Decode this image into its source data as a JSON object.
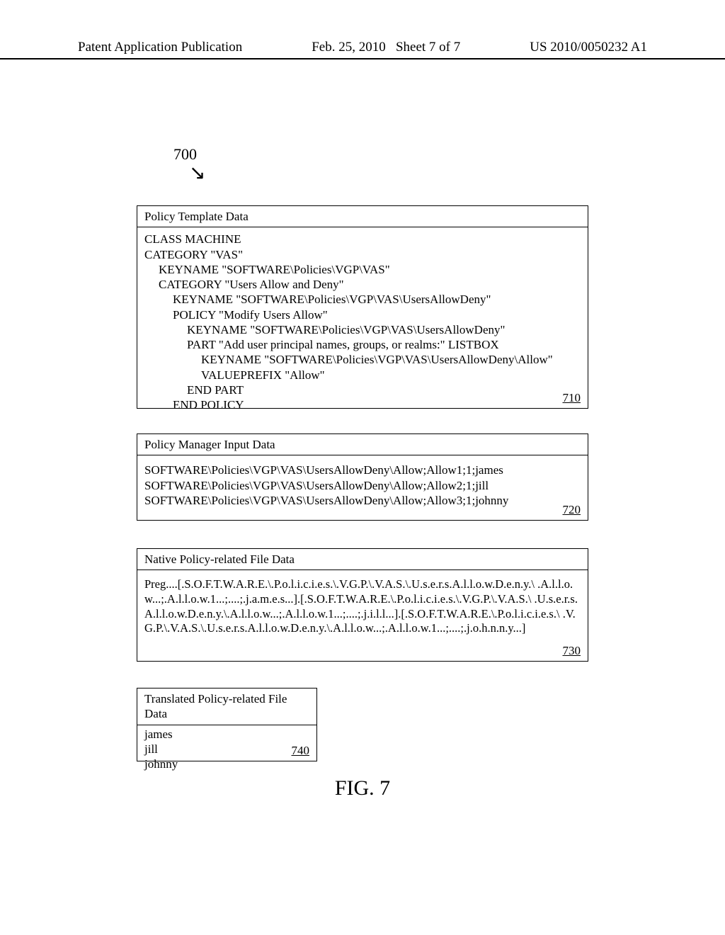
{
  "header": {
    "left": "Patent Application Publication",
    "center": "Feb. 25, 2010   Sheet 7 of 7",
    "right": "US 2010/0050232 A1"
  },
  "ref700": "700",
  "box710": {
    "title": "Policy Template Data",
    "l1": "CLASS MACHINE",
    "l2": "CATEGORY \"VAS\"",
    "l3": "KEYNAME \"SOFTWARE\\Policies\\VGP\\VAS\"",
    "l4": "CATEGORY \"Users Allow and Deny\"",
    "l5": "KEYNAME \"SOFTWARE\\Policies\\VGP\\VAS\\UsersAllowDeny\"",
    "l6": "POLICY \"Modify Users Allow\"",
    "l7": "KEYNAME \"SOFTWARE\\Policies\\VGP\\VAS\\UsersAllowDeny\"",
    "l8": "PART \"Add user principal names, groups, or realms:\" LISTBOX",
    "l9": "KEYNAME \"SOFTWARE\\Policies\\VGP\\VAS\\UsersAllowDeny\\Allow\"",
    "l10": "VALUEPREFIX \"Allow\"",
    "l11": "END PART",
    "l12": "END POLICY",
    "ref": "710"
  },
  "box720": {
    "title": "Policy Manager Input Data",
    "l1": "SOFTWARE\\Policies\\VGP\\VAS\\UsersAllowDeny\\Allow;Allow1;1;james",
    "l2": "SOFTWARE\\Policies\\VGP\\VAS\\UsersAllowDeny\\Allow;Allow2;1;jill",
    "l3": "SOFTWARE\\Policies\\VGP\\VAS\\UsersAllowDeny\\Allow;Allow3;1;johnny",
    "ref": "720"
  },
  "box730": {
    "title": "Native Policy-related File Data",
    "body": "Preg....[.S.O.F.T.W.A.R.E.\\.P.o.l.i.c.i.e.s.\\.V.G.P.\\.V.A.S.\\.U.s.e.r.s.A.l.l.o.w.D.e.n.y.\\ .A.l.l.o.w...;.A.l.l.o.w.1...;....;.j.a.m.e.s...].[.S.O.F.T.W.A.R.E.\\.P.o.l.i.c.i.e.s.\\.V.G.P.\\.V.A.S.\\ .U.s.e.r.s.A.l.l.o.w.D.e.n.y.\\.A.l.l.o.w...;.A.l.l.o.w.1...;....;.j.i.l.l...].[.S.O.F.T.W.A.R.E.\\.P.o.l.i.c.i.e.s.\\ .V.G.P.\\.V.A.S.\\.U.s.e.r.s.A.l.l.o.w.D.e.n.y.\\.A.l.l.o.w...;.A.l.l.o.w.1...;....;.j.o.h.n.n.y...]",
    "ref": "730"
  },
  "box740": {
    "title": "Translated Policy-related File Data",
    "l1": "james",
    "l2": "jill",
    "l3": "johnny",
    "ref": "740"
  },
  "figure_label": "FIG. 7"
}
